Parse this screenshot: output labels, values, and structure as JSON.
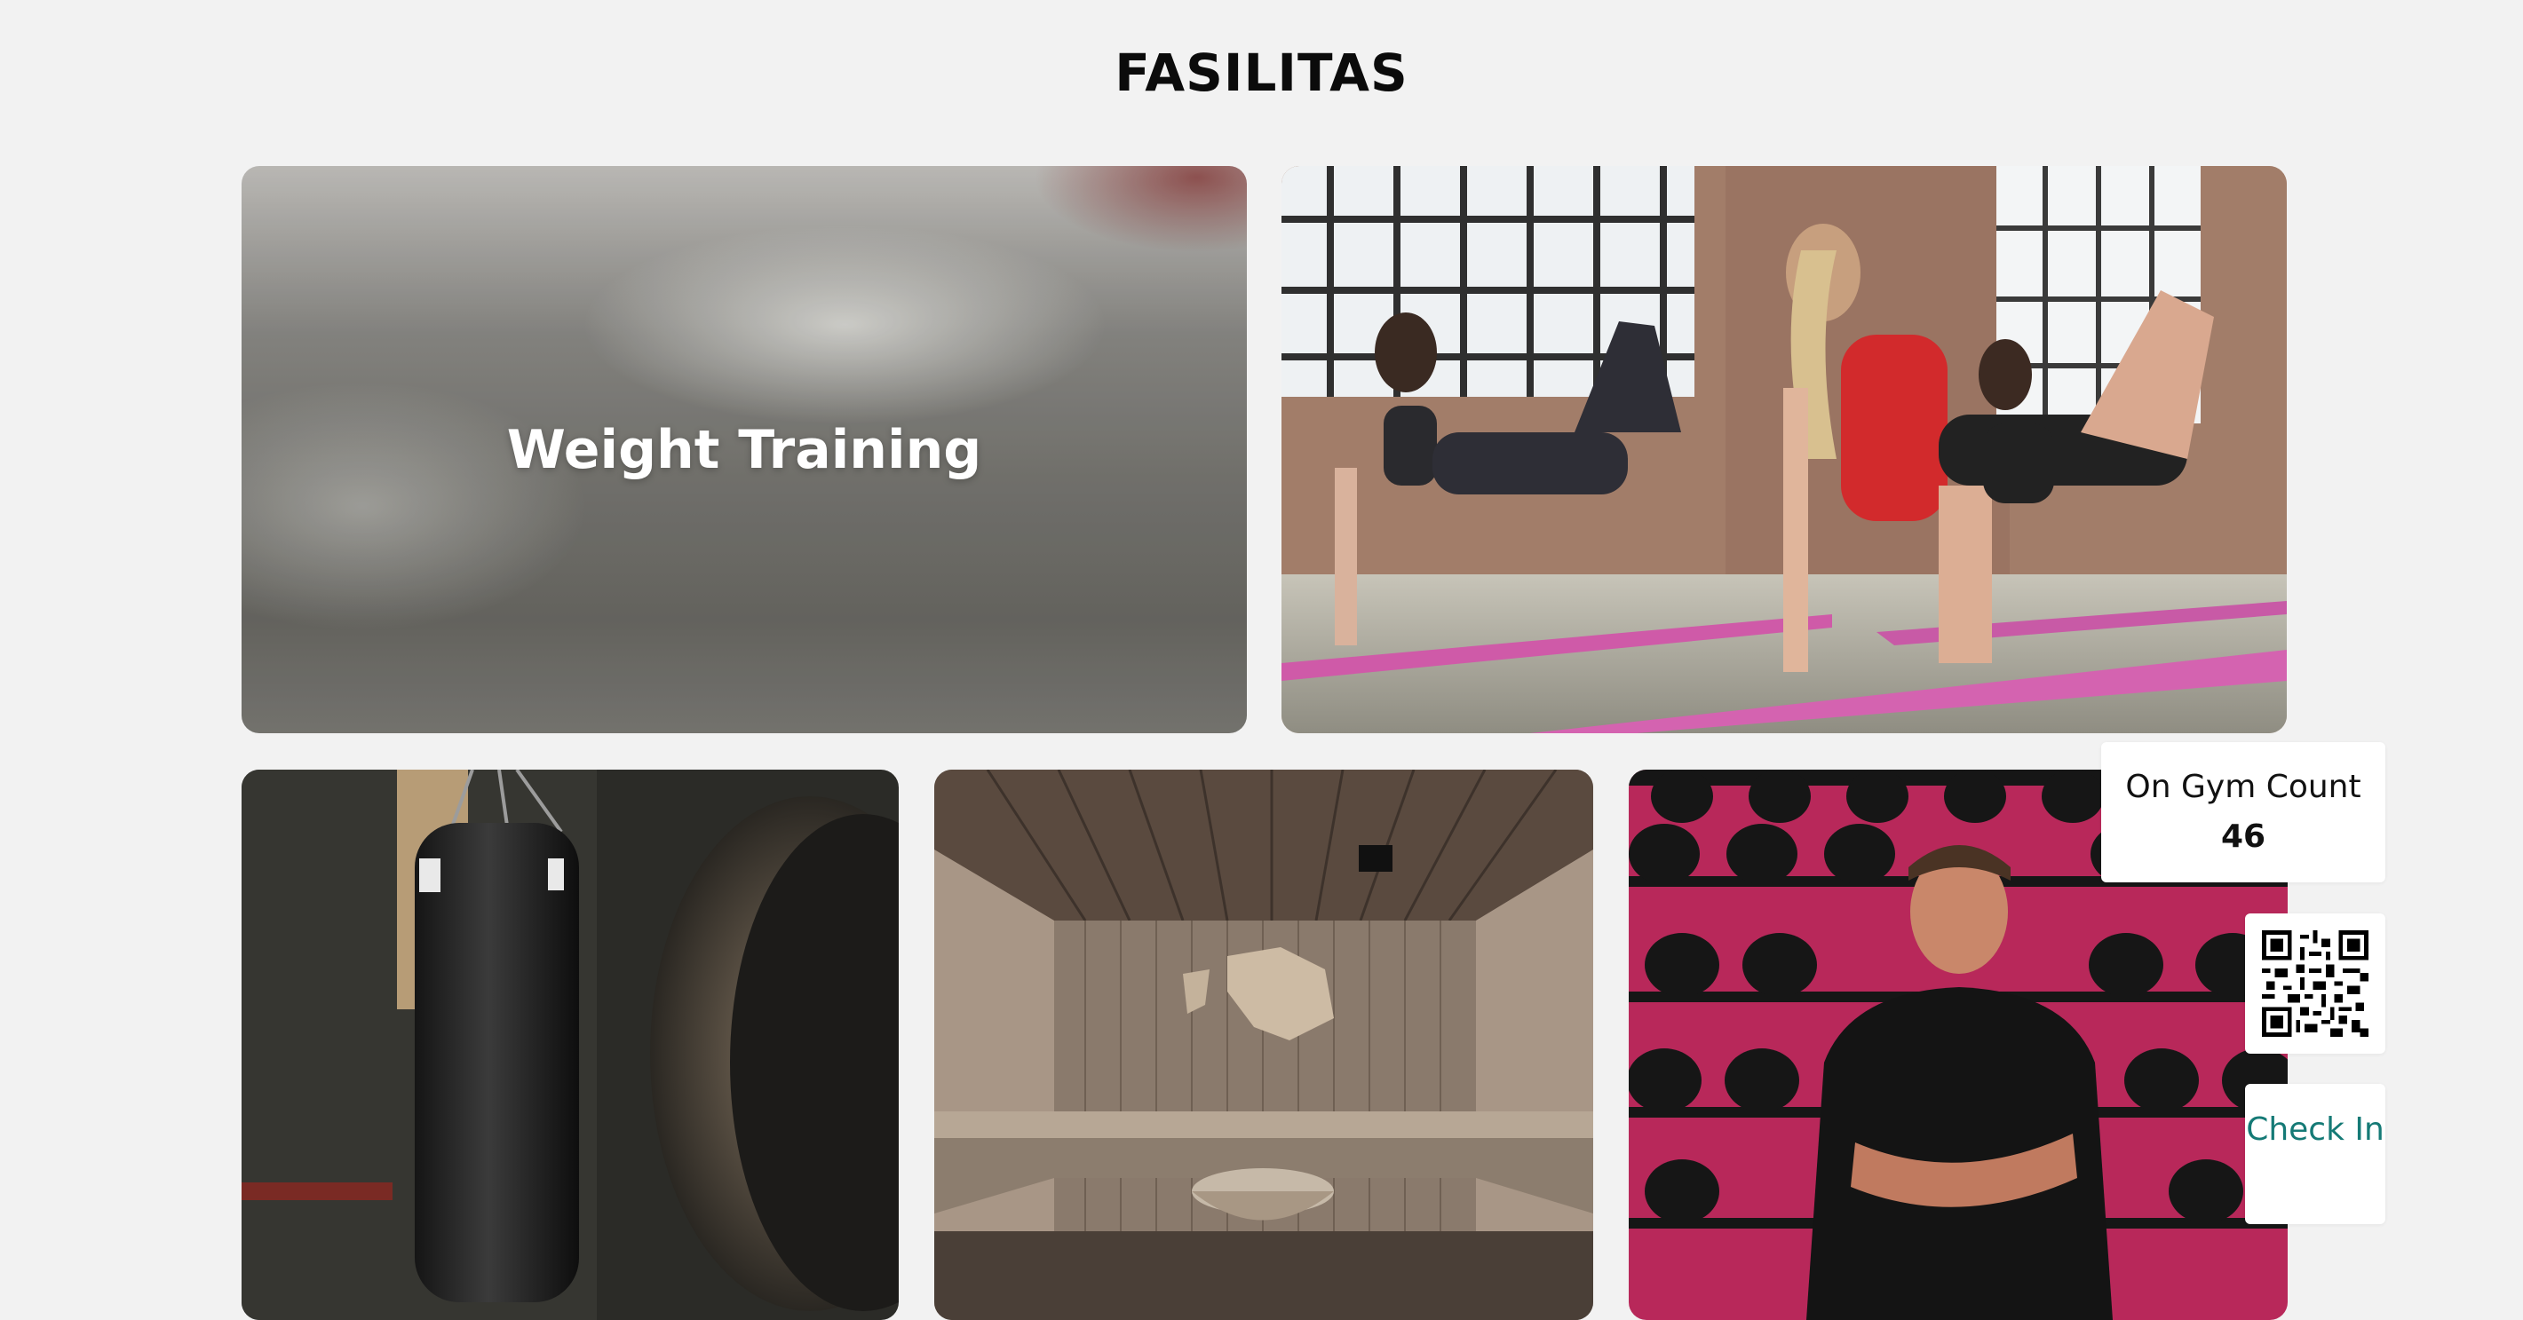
{
  "page": {
    "title": "FASILITAS"
  },
  "facilities": [
    {
      "label": "Weight Training",
      "image": "gym-equipment-blurred"
    },
    {
      "label": "",
      "image": "women-exercising-on-pink-yoga-mats"
    },
    {
      "label": "",
      "image": "hanging-punching-bag"
    },
    {
      "label": "",
      "image": "wooden-sauna-room"
    },
    {
      "label": "",
      "image": "trainer-in-front-of-boxing-glove-wall"
    }
  ],
  "gym_count": {
    "label": "On Gym Count",
    "value": "46"
  },
  "qr": {
    "icon": "qr-code-icon"
  },
  "check_in": {
    "label": "Check In"
  },
  "colors": {
    "background": "#f2f2f2",
    "check_in_text": "#157a76",
    "panel": "#ffffff"
  }
}
